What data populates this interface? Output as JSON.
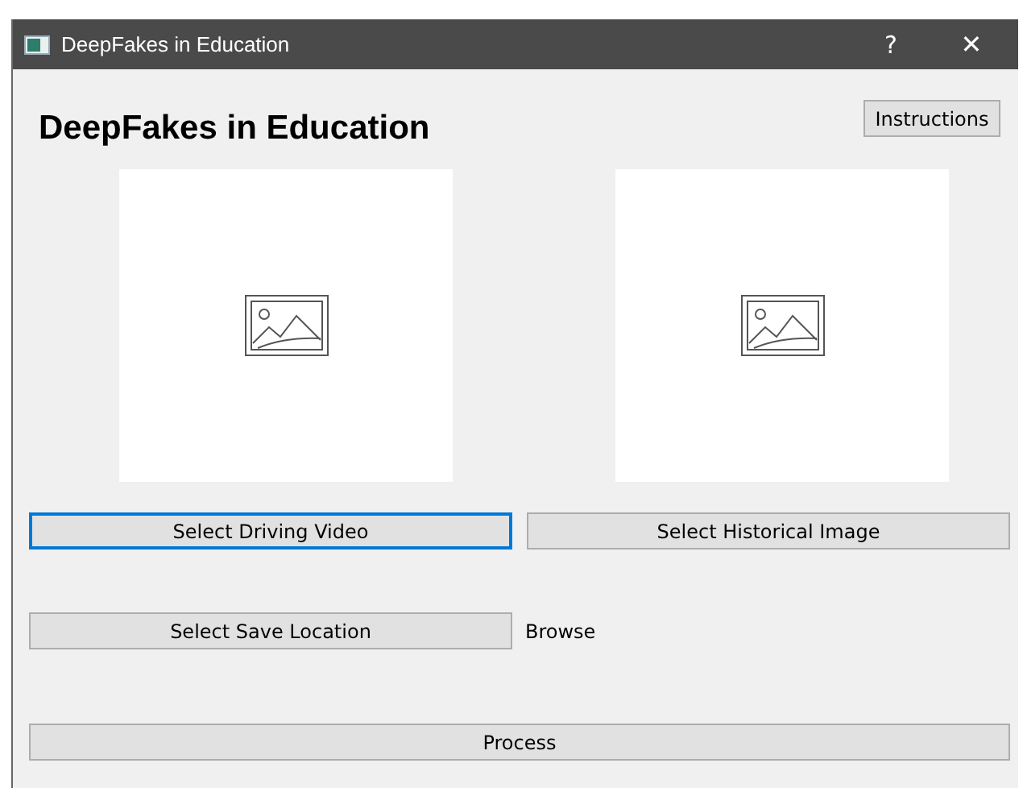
{
  "window": {
    "title": "DeepFakes in Education",
    "help": "?",
    "close": "✕"
  },
  "heading": "DeepFakes in Education",
  "instructions_button": "Instructions",
  "previews": [
    {
      "kind": "placeholder"
    },
    {
      "kind": "placeholder"
    }
  ],
  "source_buttons": [
    {
      "label": "Select Driving Video",
      "focused": true
    },
    {
      "label": "Select Historical Image",
      "focused": false
    }
  ],
  "save_button": {
    "label": "Select Save Location",
    "focused": false
  },
  "save_path": "Browse",
  "process_button": {
    "label": "Process",
    "focused": false
  }
}
